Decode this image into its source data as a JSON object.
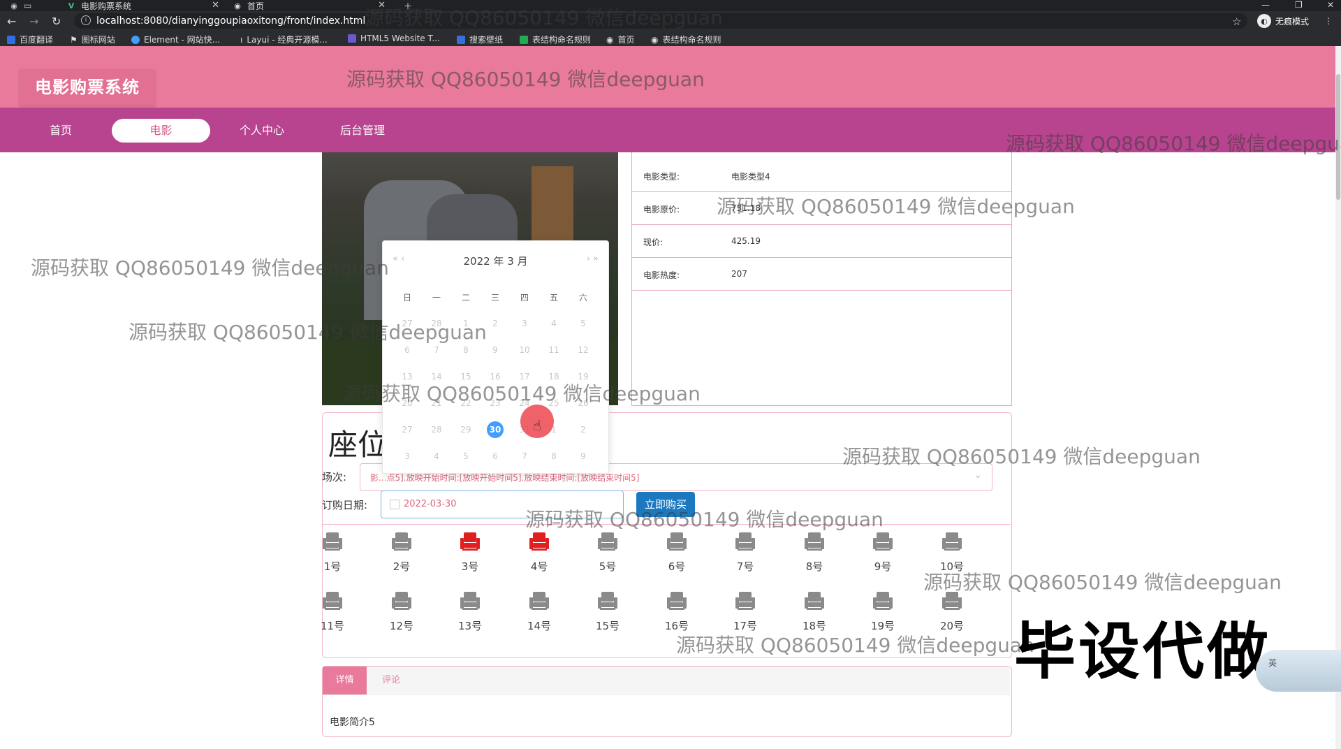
{
  "browser": {
    "tabs": [
      {
        "title": "电影购票系统",
        "icon": "vue-icon"
      },
      {
        "title": "首页",
        "icon": "globe-icon"
      }
    ],
    "url": "localhost:8080/dianyinggoupiaoxitong/front/index.html",
    "incognito_label": "无痕模式",
    "bookmarks": [
      {
        "label": "百度翻译",
        "color": "#2f6fe4"
      },
      {
        "label": "图标网站",
        "color": "#ffffff"
      },
      {
        "label": "Element - 网站快...",
        "color": "#409eff"
      },
      {
        "label": "Layui - 经典开源模...",
        "color": "#aaaaaa"
      },
      {
        "label": "HTML5 Website T...",
        "color": "#6a5acd"
      },
      {
        "label": "搜索壁纸",
        "color": "#3b6dd8"
      },
      {
        "label": "表结构命名规则",
        "color": "#22aa55"
      },
      {
        "label": "首页",
        "color": "#cccccc"
      },
      {
        "label": "表结构命名规则",
        "color": "#cccccc"
      }
    ]
  },
  "site": {
    "title": "电影购票系统",
    "nav": [
      {
        "label": "首页",
        "active": false
      },
      {
        "label": "电影",
        "active": true
      },
      {
        "label": "个人中心",
        "active": false
      },
      {
        "label": "后台管理",
        "active": false
      }
    ],
    "colors": {
      "header": "#e97a9c",
      "nav": "#b8438f",
      "accent": "#409eff",
      "buy": "#1c79c0",
      "seat_taken": "#e02020",
      "seat_free": "#8a8a8a"
    }
  },
  "movie_info": [
    {
      "label": "电影类型:",
      "value": "电影类型4"
    },
    {
      "label": "电影原价:",
      "value": "731.18"
    },
    {
      "label": "现价:",
      "value": "425.19"
    },
    {
      "label": "电影热度:",
      "value": "207"
    }
  ],
  "seating": {
    "title": "座位",
    "session_label": "场次:",
    "session_value": "影...点5].放映开始时间:[放映开始时间5].放映结束时间:[放映结束时间5]",
    "date_label": "订购日期:",
    "date_value": "2022-03-30",
    "buy_button": "立即购买",
    "seats": [
      {
        "label": "1号",
        "taken": false
      },
      {
        "label": "2号",
        "taken": false
      },
      {
        "label": "3号",
        "taken": true
      },
      {
        "label": "4号",
        "taken": true
      },
      {
        "label": "5号",
        "taken": false
      },
      {
        "label": "6号",
        "taken": false
      },
      {
        "label": "7号",
        "taken": false
      },
      {
        "label": "8号",
        "taken": false
      },
      {
        "label": "9号",
        "taken": false
      },
      {
        "label": "10号",
        "taken": false
      },
      {
        "label": "11号",
        "taken": false
      },
      {
        "label": "12号",
        "taken": false
      },
      {
        "label": "13号",
        "taken": false
      },
      {
        "label": "14号",
        "taken": false
      },
      {
        "label": "15号",
        "taken": false
      },
      {
        "label": "16号",
        "taken": false
      },
      {
        "label": "17号",
        "taken": false
      },
      {
        "label": "18号",
        "taken": false
      },
      {
        "label": "19号",
        "taken": false
      },
      {
        "label": "20号",
        "taken": false
      }
    ]
  },
  "datepicker": {
    "header": "2022 年  3 月",
    "prev": "«  ‹",
    "next": "›  »",
    "weekdays": [
      "日",
      "一",
      "二",
      "三",
      "四",
      "五",
      "六"
    ],
    "days": [
      [
        "27",
        "28",
        "1",
        "2",
        "3",
        "4",
        "5"
      ],
      [
        "6",
        "7",
        "8",
        "9",
        "10",
        "11",
        "12"
      ],
      [
        "13",
        "14",
        "15",
        "16",
        "17",
        "18",
        "19"
      ],
      [
        "20",
        "21",
        "22",
        "23",
        "24",
        "25",
        "26"
      ],
      [
        "27",
        "28",
        "29",
        "30",
        "31",
        "1",
        "2"
      ],
      [
        "3",
        "4",
        "5",
        "6",
        "7",
        "8",
        "9"
      ]
    ],
    "selected": "30"
  },
  "detail_tabs": {
    "tabs": [
      "详情",
      "评论"
    ],
    "active": "详情",
    "content": "电影简介5"
  },
  "watermark": "源码获取 QQ86050149 微信deepguan",
  "promo": "毕设代做",
  "ime_label": "英"
}
